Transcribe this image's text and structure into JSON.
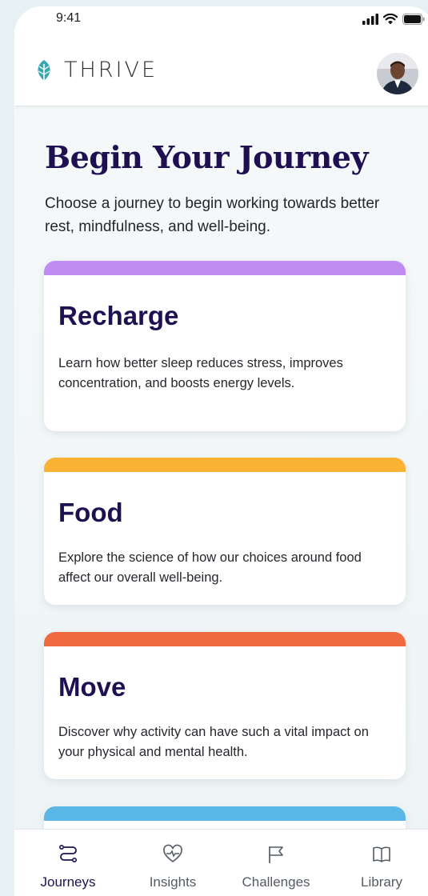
{
  "status_bar": {
    "time": "9:41",
    "icons": [
      "signal-icon",
      "wifi-icon",
      "battery-icon"
    ]
  },
  "header": {
    "logo_text": "THRIVE",
    "logo_icon": "leaf-icon",
    "logo_color": "#3aa8ae",
    "avatar": "user-avatar"
  },
  "main": {
    "title": "Begin Your Journey",
    "subtitle": "Choose a journey to begin working towards better rest, mindfulness, and well-being.",
    "cards": [
      {
        "title": "Recharge",
        "description": "Learn how better sleep reduces stress, improves concentration, and boosts energy levels.",
        "accent": "#bf8cf2"
      },
      {
        "title": "Food",
        "description": "Explore the science of how our choices around food affect our overall well-being.",
        "accent": "#f9b233"
      },
      {
        "title": "Move",
        "description": "Discover why activity can have such a vital impact on your physical and mental health.",
        "accent": "#ef6b3f"
      },
      {
        "accent": "#5ab6e6"
      }
    ]
  },
  "bottom_nav": {
    "items": [
      {
        "label": "Journeys",
        "icon": "route-icon",
        "active": true
      },
      {
        "label": "Insights",
        "icon": "heart-pulse-icon",
        "active": false
      },
      {
        "label": "Challenges",
        "icon": "flag-icon",
        "active": false
      },
      {
        "label": "Library",
        "icon": "book-icon",
        "active": false
      }
    ]
  },
  "colors": {
    "primary_text": "#1f1151",
    "background": "#e5f1f3"
  }
}
